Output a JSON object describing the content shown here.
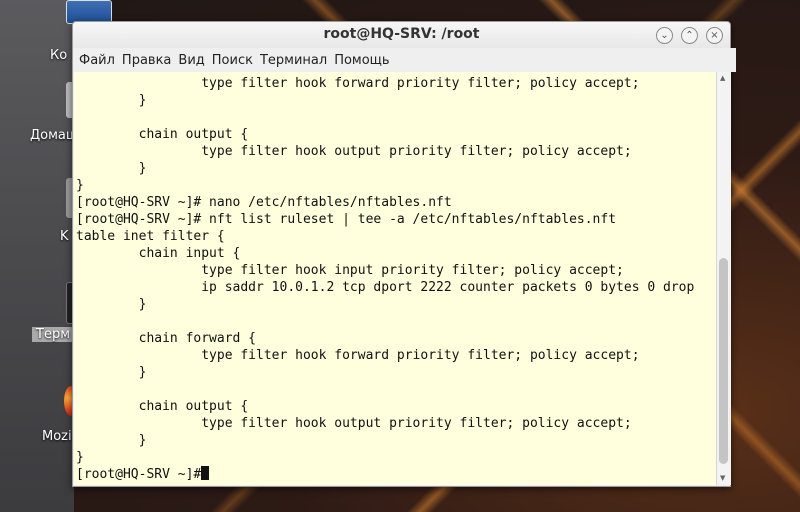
{
  "window": {
    "title": "root@HQ-SRV: /root",
    "minimize_glyph": "⌄",
    "maximize_glyph": "⌃",
    "close_glyph": "×"
  },
  "menu": [
    "Файл",
    "Правка",
    "Вид",
    "Поиск",
    "Терминал",
    "Помощь"
  ],
  "desktop": {
    "icons": [
      {
        "label": "Ко",
        "icon": "computer-icon"
      },
      {
        "label": "Домаш",
        "icon": "home-folder-icon"
      },
      {
        "label": "K",
        "icon": "trash-icon"
      },
      {
        "label": "Терм",
        "icon": "terminal-icon"
      },
      {
        "label": "Mozi",
        "icon": "firefox-icon"
      }
    ]
  },
  "terminal": {
    "lines": [
      "                type filter hook forward priority filter; policy accept;",
      "        }",
      "",
      "        chain output {",
      "                type filter hook output priority filter; policy accept;",
      "        }",
      "}",
      "[root@HQ-SRV ~]# nano /etc/nftables/nftables.nft",
      "[root@HQ-SRV ~]# nft list ruleset | tee -a /etc/nftables/nftables.nft",
      "table inet filter {",
      "        chain input {",
      "                type filter hook input priority filter; policy accept;",
      "                ip saddr 10.0.1.2 tcp dport 2222 counter packets 0 bytes 0 drop",
      "        }",
      "",
      "        chain forward {",
      "                type filter hook forward priority filter; policy accept;",
      "        }",
      "",
      "        chain output {",
      "                type filter hook output priority filter; policy accept;",
      "        }",
      "}"
    ],
    "prompt": "[root@HQ-SRV ~]#"
  }
}
